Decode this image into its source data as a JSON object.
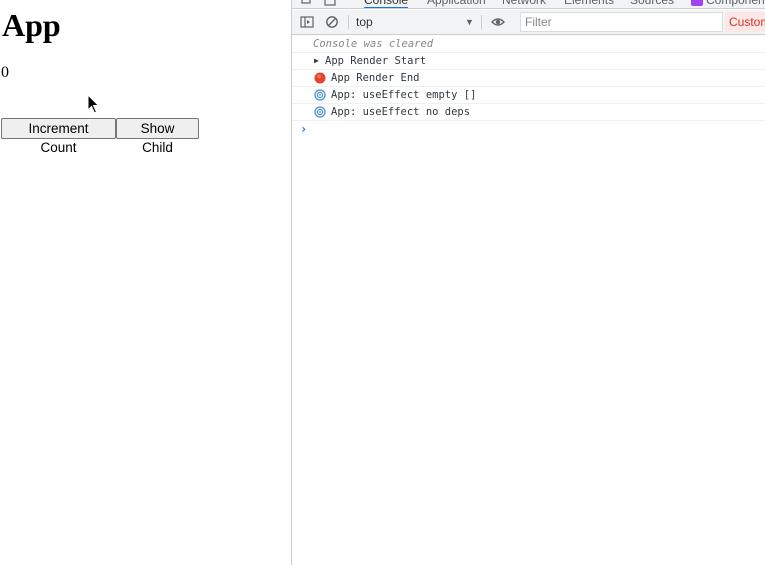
{
  "app": {
    "title": "App",
    "count": "0",
    "increment_label": "Increment Count",
    "show_child_label": "Show Child"
  },
  "devtools": {
    "tabs": [
      "Console",
      "Application",
      "Network",
      "Elements",
      "Sources",
      "Components"
    ],
    "active_tab": "Console",
    "context": "top",
    "filter_placeholder": "Filter",
    "levels_label": "Custom levels",
    "log": {
      "cleared": "Console was cleared",
      "entries": [
        "App Render Start",
        "App Render End",
        "App: useEffect empty []",
        "App: useEffect no deps"
      ]
    },
    "prompt": "›"
  },
  "colors": {
    "accent": "#1a73e8",
    "error_red": "#d93025",
    "toolbar_bg": "#f1f3f4",
    "render_end_badge": "#e8432a",
    "use_effect_icon": "#4a90d9"
  },
  "icons": {
    "render_start": "expand-triangle-icon",
    "render_end": "red-circle-icon",
    "use_effect": "spiral-icon"
  }
}
